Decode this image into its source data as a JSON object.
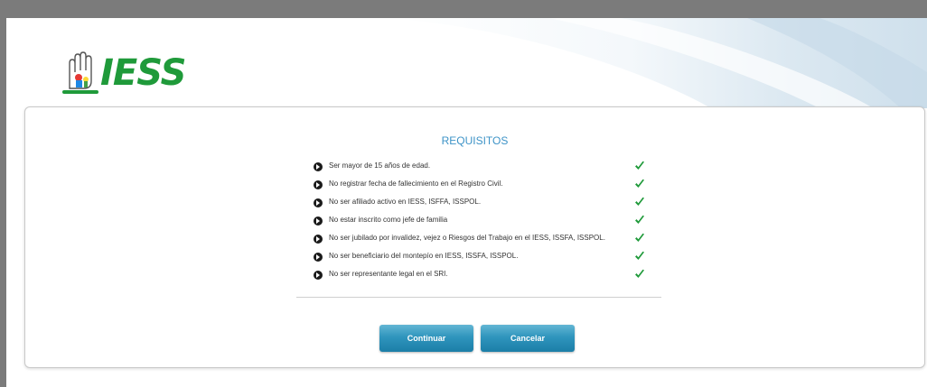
{
  "brand": {
    "logo_text": "IESS",
    "primary_color": "#1f9a3a",
    "accent_color": "#3d93c7"
  },
  "requirements": {
    "title": "REQUISITOS",
    "items": [
      {
        "text": "Ser mayor de 15 años de edad.",
        "status_icon": "check-icon"
      },
      {
        "text": "No registrar fecha de fallecimiento en el Registro Civil.",
        "status_icon": "check-icon"
      },
      {
        "text": "No ser afiliado activo en IESS, ISFFA, ISSPOL.",
        "status_icon": "check-icon"
      },
      {
        "text": "No estar inscrito como jefe de familia",
        "status_icon": "check-icon"
      },
      {
        "text": "No ser jubilado por invalidez, vejez o Riesgos del Trabajo en el IESS, ISSFA, ISSPOL.",
        "status_icon": "check-icon"
      },
      {
        "text": "No ser beneficiario del montepío en IESS, ISSFA, ISSPOL.",
        "status_icon": "check-icon"
      },
      {
        "text": "No ser representante legal en el SRI.",
        "status_icon": "check-icon"
      }
    ]
  },
  "actions": {
    "continue_label": "Continuar",
    "cancel_label": "Cancelar",
    "button_color": "#2f95bd"
  }
}
